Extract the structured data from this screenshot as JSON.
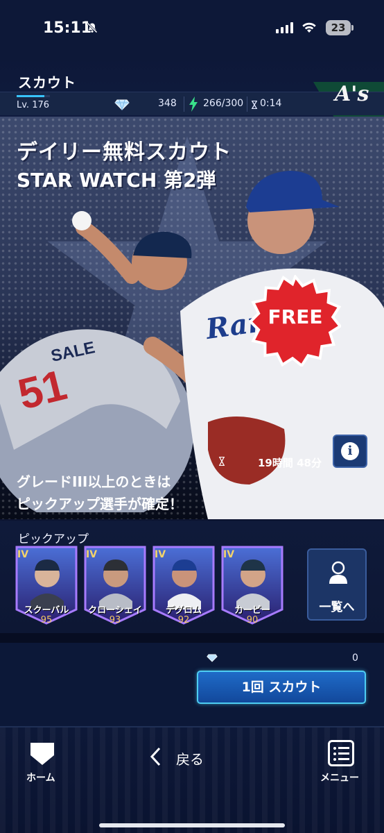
{
  "status_bar": {
    "time": "15:11",
    "battery": "23",
    "icons": [
      "bell-slash-icon",
      "signal-icon",
      "wifi-icon",
      "battery-icon"
    ]
  },
  "header": {
    "title": "スカウト",
    "level": "Lv. 176",
    "gems": "348",
    "stamina": "266/300",
    "timer": "0:14",
    "team_logo": "A's",
    "team_color": "#0f4a36"
  },
  "banner": {
    "title_line1": "デイリー無料スカウト",
    "title_line2": "STAR WATCH 第2弾",
    "free_badge": "FREE",
    "time_left": "19時間 48分",
    "description_line1": "グレードIII以上のときは",
    "description_line2": "ピックアップ選手が確定！",
    "left_jersey": "SALE",
    "left_number": "51",
    "right_team": "Rangers"
  },
  "pickup": {
    "label": "ピックアップ",
    "cards": [
      {
        "name": "スクーバル",
        "rating": "95",
        "grade": "IV"
      },
      {
        "name": "クローシェイ",
        "rating": "93",
        "grade": "IV"
      },
      {
        "name": "デグロム",
        "rating": "92",
        "grade": "IV"
      },
      {
        "name": "カービー",
        "rating": "90",
        "grade": "IV"
      }
    ],
    "list_button": "一覧へ"
  },
  "scout": {
    "cost": "0",
    "button_label": "1回 スカウト"
  },
  "nav": {
    "home": "ホーム",
    "back": "戻る",
    "menu": "メニュー"
  },
  "colors": {
    "accent": "#1f6bc8",
    "free_red": "#e0242b",
    "card_purple": "#6b3fd2"
  }
}
